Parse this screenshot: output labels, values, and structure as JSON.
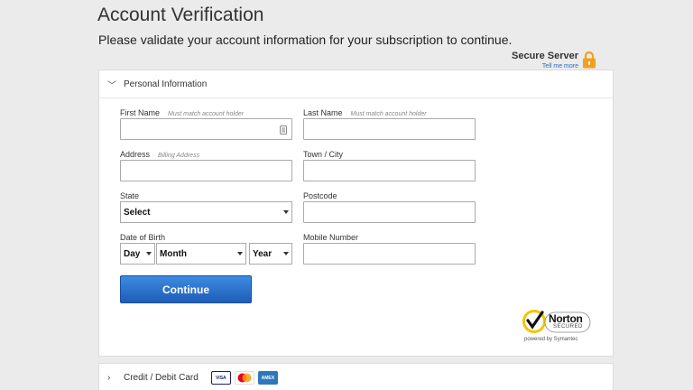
{
  "header": {
    "title": "Account Verification",
    "subtitle": "Please validate your account information for your subscription to continue."
  },
  "secure": {
    "label": "Secure Server",
    "link": "Tell me more",
    "icon": "lock-icon"
  },
  "personal_section": {
    "title": "Personal Information",
    "icon": "chevron-down-icon",
    "fields": {
      "first_name": {
        "label": "First Name",
        "hint": "Must match account holder",
        "value": ""
      },
      "last_name": {
        "label": "Last Name",
        "hint": "Must match account holder",
        "value": ""
      },
      "address": {
        "label": "Address",
        "hint": "Billing Address",
        "value": ""
      },
      "town": {
        "label": "Town / City",
        "value": ""
      },
      "state": {
        "label": "State",
        "value": "Select"
      },
      "postcode": {
        "label": "Postcode",
        "value": ""
      },
      "dob": {
        "label": "Date of Birth",
        "day": "Day",
        "month": "Month",
        "year": "Year"
      },
      "mobile": {
        "label": "Mobile Number",
        "value": ""
      }
    },
    "continue_label": "Continue"
  },
  "norton": {
    "name": "Norton",
    "secured": "SECURED",
    "powered": "powered by Symantec"
  },
  "card_section": {
    "title": "Credit / Debit Card",
    "icon": "chevron-right-icon",
    "cards": [
      "VISA",
      "AMEX"
    ]
  },
  "colors": {
    "accent": "#1d5db8",
    "lock": "#f0a020",
    "norton_yellow": "#f5c400"
  }
}
